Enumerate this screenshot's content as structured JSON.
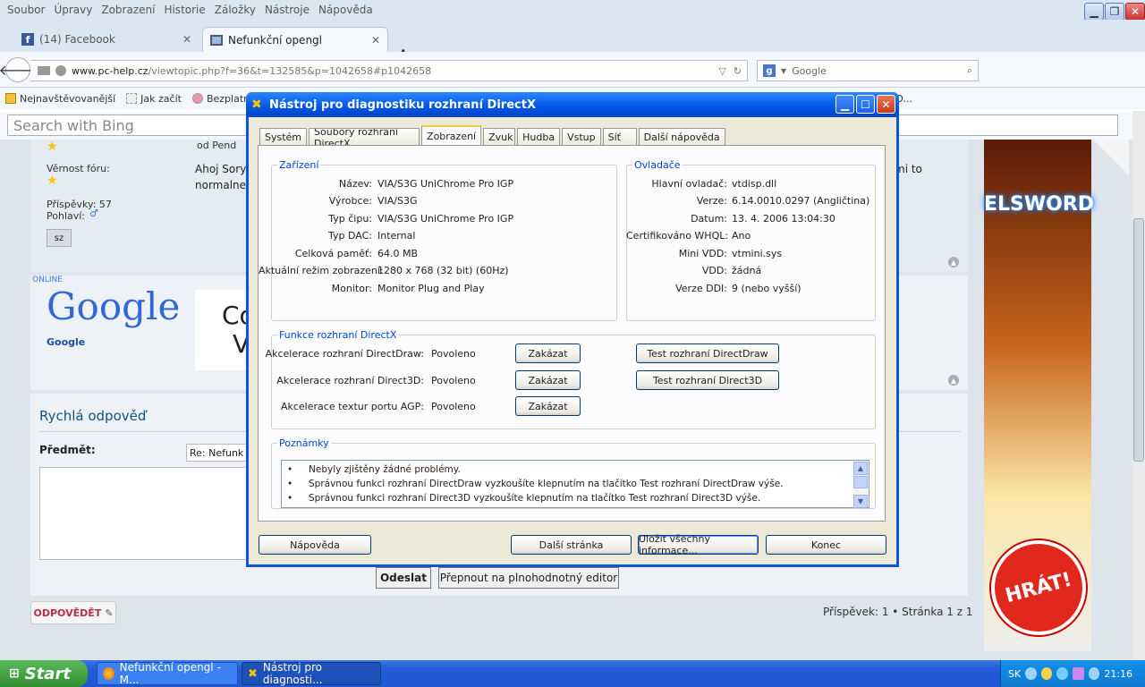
{
  "browser": {
    "menu": [
      "Soubor",
      "Úpravy",
      "Zobrazení",
      "Historie",
      "Záložky",
      "Nástroje",
      "Nápověda"
    ],
    "tabs": [
      {
        "label": "(14) Facebook"
      },
      {
        "label": "Nefunkční opengl"
      }
    ],
    "url": {
      "host": "www.pc-help.cz",
      "path": "/viewtopic.php?f=36&t=132585&p=1042658#p1042658"
    },
    "search_placeholder": "Google",
    "bookmarks": [
      "Nejnavštěvovanější",
      "Jak začít",
      "Bezplatné hr…",
      "– HO..."
    ],
    "bing_placeholder": "Search with Bing"
  },
  "forum": {
    "post1": {
      "label_vernost": "Věrnost fóru:",
      "label_prispevky": "Příspěvky: 57",
      "label_pohlavi": "Pohlaví:",
      "from": "od Pend",
      "text1": "Ahoj Sory",
      "text2": "normalne",
      "text_right": "mi to",
      "badge": "sz"
    },
    "post2": {
      "online": "ONLINE",
      "google_logo": "Google",
      "google_name": "Google",
      "snippet1": "Co",
      "snippet2": "V"
    },
    "reply": {
      "title": "Rychlá odpověď",
      "subject_label": "Předmět:",
      "subject_value": "Re: Nefunk",
      "send": "Odeslat",
      "full_editor": "Přepnout na plnohodnotný editor"
    },
    "answer_button": "ODPOVĚDĚT",
    "pagination": "Příspěvek: 1 • Stránka 1 z 1"
  },
  "ad": {
    "brand": "ELSWORD",
    "cta": "HRÁT!"
  },
  "taskbar": {
    "start": "Start",
    "tasks": [
      "Nefunkční opengl - M...",
      "Nástroj pro diagnosti..."
    ],
    "lang": "SK",
    "clock": "21:16"
  },
  "dialog": {
    "title": "Nástroj pro diagnostiku rozhraní DirectX",
    "tabs": [
      "Systém",
      "Soubory rozhraní DirectX",
      "Zobrazení",
      "Zvuk",
      "Hudba",
      "Vstup",
      "Síť",
      "Další nápověda"
    ],
    "device": {
      "legend": "Zařízení",
      "rows": [
        {
          "k": "Název:",
          "v": "VIA/S3G UniChrome Pro IGP"
        },
        {
          "k": "Výrobce:",
          "v": "VIA/S3G"
        },
        {
          "k": "Typ čipu:",
          "v": "VIA/S3G UniChrome Pro IGP"
        },
        {
          "k": "Typ DAC:",
          "v": "Internal"
        },
        {
          "k": "Celková paměť:",
          "v": "64.0 MB"
        },
        {
          "k": "Aktuální režim zobrazení:",
          "v": "1280 x 768 (32 bit) (60Hz)"
        },
        {
          "k": "Monitor:",
          "v": "Monitor Plug and Play"
        }
      ]
    },
    "drivers": {
      "legend": "Ovladače",
      "rows": [
        {
          "k": "Hlavní ovladač:",
          "v": "vtdisp.dll"
        },
        {
          "k": "Verze:",
          "v": "6.14.0010.0297 (Angličtina)"
        },
        {
          "k": "Datum:",
          "v": "13. 4. 2006 13:04:30"
        },
        {
          "k": "Certifikováno WHQL:",
          "v": "Ano"
        },
        {
          "k": "Mini VDD:",
          "v": "vtmini.sys"
        },
        {
          "k": "VDD:",
          "v": "žádná"
        },
        {
          "k": "Verze DDI:",
          "v": "9 (nebo vyšší)"
        }
      ]
    },
    "features": {
      "legend": "Funkce rozhraní DirectX",
      "rows": [
        {
          "k": "Akcelerace rozhraní DirectDraw:",
          "v": "Povoleno",
          "btn": "Zakázat",
          "test": "Test rozhraní DirectDraw"
        },
        {
          "k": "Akcelerace rozhraní Direct3D:",
          "v": "Povoleno",
          "btn": "Zakázat",
          "test": "Test rozhraní Direct3D"
        },
        {
          "k": "Akcelerace textur portu AGP:",
          "v": "Povoleno",
          "btn": "Zakázat"
        }
      ]
    },
    "notes": {
      "legend": "Poznámky",
      "items": [
        "Nebyly zjištěny žádné problémy.",
        "Správnou funkci rozhraní DirectDraw vyzkoušíte klepnutím na tlačítko Test rozhraní DirectDraw výše.",
        "Správnou funkci rozhraní Direct3D vyzkoušíte klepnutím na tlačítko Test rozhraní Direct3D výše."
      ]
    },
    "buttons": {
      "help": "Nápověda",
      "next": "Další stránka",
      "save": "Uložit všechny informace...",
      "exit": "Konec"
    }
  }
}
